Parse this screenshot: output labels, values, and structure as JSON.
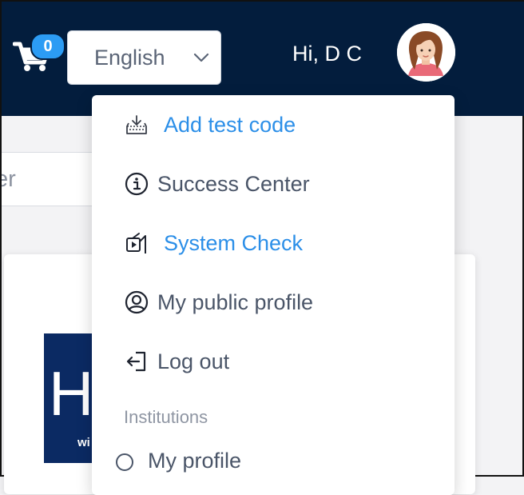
{
  "header": {
    "cart_count": "0",
    "language": "English",
    "greeting": "Hi, D C"
  },
  "search": {
    "partial_placeholder": "er"
  },
  "banner": {
    "letter": "H",
    "small_text": "wi"
  },
  "menu": {
    "items": [
      {
        "label": "Add test code",
        "icon": "download-tray-icon",
        "style": "link"
      },
      {
        "label": "Success Center",
        "icon": "info-icon",
        "style": "plain"
      },
      {
        "label": "System Check",
        "icon": "video-check-icon",
        "style": "link"
      },
      {
        "label": "My public profile",
        "icon": "user-circle-icon",
        "style": "plain"
      },
      {
        "label": "Log out",
        "icon": "logout-icon",
        "style": "plain"
      }
    ],
    "section_heading": "Institutions",
    "institution_items": [
      {
        "label": "My profile",
        "selected": false
      }
    ]
  },
  "colors": {
    "nav_background": "#031d3d",
    "badge": "#2c9cf4",
    "link": "#2c8fe8",
    "text": "#4a5568"
  }
}
